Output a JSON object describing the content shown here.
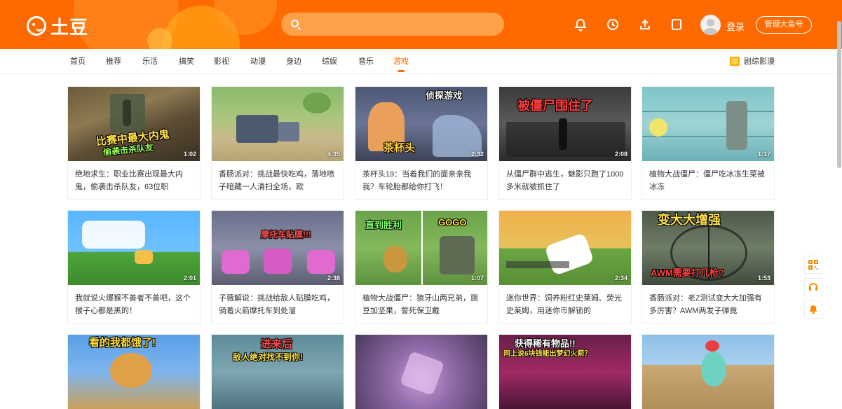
{
  "header": {
    "logo_text": "土豆",
    "search_placeholder": "",
    "login_label": "登录",
    "manage_label": "管理大鱼号",
    "icons": [
      "bell-icon",
      "clock-icon",
      "upload-icon",
      "tablet-icon"
    ],
    "brand_color": "#ff6a00"
  },
  "nav": {
    "items": [
      {
        "label": "首页"
      },
      {
        "label": "推荐"
      },
      {
        "label": "乐活"
      },
      {
        "label": "搞笑"
      },
      {
        "label": "影视"
      },
      {
        "label": "动漫"
      },
      {
        "label": "身边"
      },
      {
        "label": "综娱"
      },
      {
        "label": "音乐"
      },
      {
        "label": "游戏",
        "active": true
      }
    ],
    "right_label": "剧综影漫"
  },
  "videos": [
    {
      "title": "绝地求生：职业比赛出现最大内鬼，偷袭击杀队友，63位职",
      "duration": "1:02",
      "overlay": "比赛中最大内鬼",
      "overlay2": "偷袭击杀队友"
    },
    {
      "title": "香肠派对：挑战最快吃鸡，落地喷子暗藏一人清扫全场，欺",
      "duration": "4:35",
      "overlay": "",
      "overlay2": ""
    },
    {
      "title": "茶杯头19：当着我们的面亲亲我我？车轮胎都给你打飞！",
      "duration": "2:32",
      "overlay": "侦探游戏",
      "overlay2": "茶杯头"
    },
    {
      "title": "从僵尸群中逃生，魅影只跑了1000多米就被抓住了",
      "duration": "2:08",
      "overlay": "被僵尸围住了",
      "overlay2": ""
    },
    {
      "title": "植物大战僵尸：僵尸吃冰冻生菜被冰冻",
      "duration": "1:17",
      "overlay": "",
      "overlay2": ""
    },
    {
      "title": "我就说火爆猴不善者不善吧，这个猴子心都是黑的！",
      "duration": "2:01",
      "overlay": "",
      "overlay2": ""
    },
    {
      "title": "子薇解说：挑战给敌人贴膜吃鸡，骑着火箭摩托车到处溜",
      "duration": "2:38",
      "overlay": "摩托车贴膜!!!",
      "overlay2": ""
    },
    {
      "title": "植物大战僵尸：狼牙山两兄弟，豌豆加坚果，誓死保卫戴",
      "duration": "1:07",
      "overlay": "直到胜利",
      "overlay2": "GOGO"
    },
    {
      "title": "迷你世界：饲养粉红史莱姆、荧光史莱姆，用迷你币解锁的",
      "duration": "2:34",
      "overlay": "",
      "overlay2": ""
    },
    {
      "title": "香肠派对：老Z测试变大大加强有多厉害？AWM两发子弹竟",
      "duration": "1:53",
      "overlay": "变大大增强",
      "overlay2": "AWM需要打几枪?"
    },
    {
      "title": "",
      "duration": "",
      "overlay": "看的我都饿了!",
      "overlay2": ""
    },
    {
      "title": "",
      "duration": "",
      "overlay": "进来后",
      "overlay2": "敌人绝对找不到你!"
    },
    {
      "title": "",
      "duration": "",
      "overlay": "",
      "overlay2": ""
    },
    {
      "title": "",
      "duration": "",
      "overlay": "获得稀有物品!!",
      "overlay2": "网上说6块钱能出梦幻火箭？"
    },
    {
      "title": "",
      "duration": "",
      "overlay": "",
      "overlay2": ""
    }
  ],
  "float_bar": [
    "qr-code-icon",
    "headset-icon",
    "bell-icon"
  ]
}
